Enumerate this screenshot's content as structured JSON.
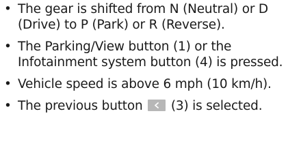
{
  "conditions": [
    {
      "text": "The gear is shifted from N (Neutral) or D (Drive) to P (Park) or R (Reverse)."
    },
    {
      "text": "The Parking/View button (1) or the Infotainment system button (4) is pressed."
    },
    {
      "text": "Vehicle speed is above 6 mph (10 km/h)."
    },
    {
      "text_before": "The previous button",
      "icon": "chevron-left-icon",
      "text_after": "(3) is selected."
    }
  ],
  "bullet": "•"
}
